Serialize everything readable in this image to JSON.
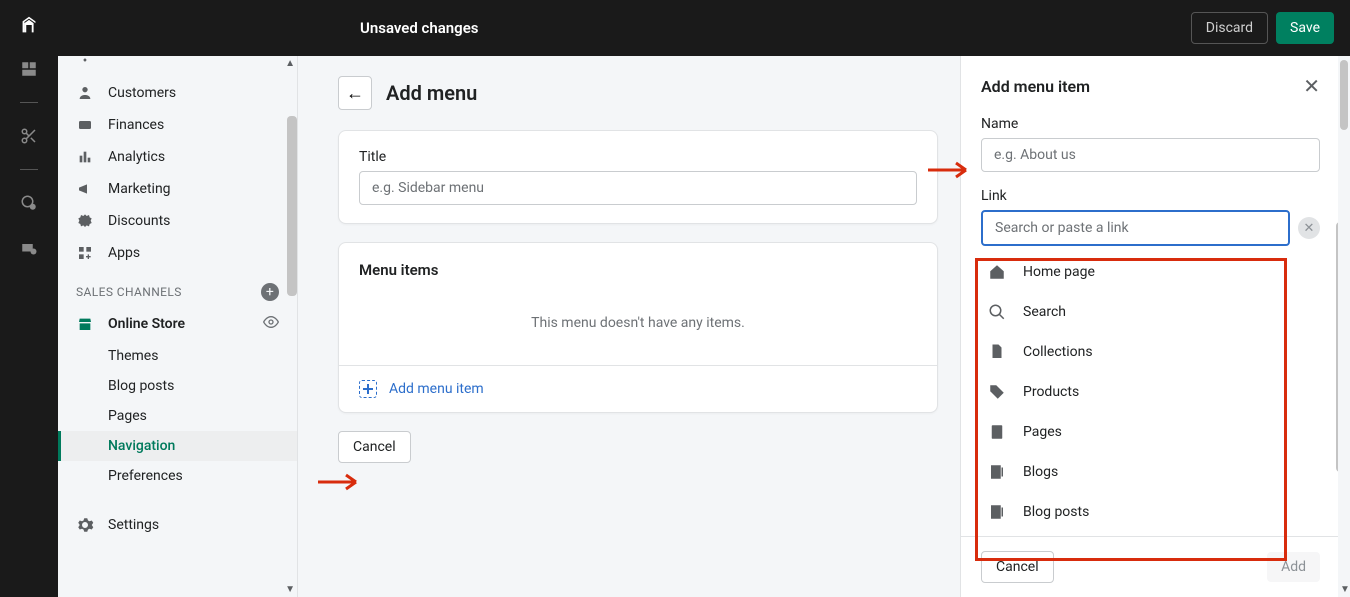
{
  "topbar": {
    "title": "Unsaved changes",
    "discard": "Discard",
    "save": "Save"
  },
  "sidebar": {
    "items": [
      {
        "label": "Customers"
      },
      {
        "label": "Finances"
      },
      {
        "label": "Analytics"
      },
      {
        "label": "Marketing"
      },
      {
        "label": "Discounts"
      },
      {
        "label": "Apps"
      }
    ],
    "section": "SALES CHANNELS",
    "channel": "Online Store",
    "subs": [
      {
        "label": "Themes"
      },
      {
        "label": "Blog posts"
      },
      {
        "label": "Pages"
      },
      {
        "label": "Navigation"
      },
      {
        "label": "Preferences"
      }
    ],
    "settings": "Settings"
  },
  "main": {
    "heading": "Add menu",
    "title_label": "Title",
    "title_placeholder": "e.g. Sidebar menu",
    "menu_items_heading": "Menu items",
    "empty_msg": "This menu doesn't have any items.",
    "add_menu_item": "Add menu item",
    "cancel": "Cancel"
  },
  "panel": {
    "heading": "Add menu item",
    "name_label": "Name",
    "name_placeholder": "e.g. About us",
    "link_label": "Link",
    "link_placeholder": "Search or paste a link",
    "options": [
      {
        "label": "Home page",
        "icon": "home"
      },
      {
        "label": "Search",
        "icon": "search"
      },
      {
        "label": "Collections",
        "icon": "collections"
      },
      {
        "label": "Products",
        "icon": "tag"
      },
      {
        "label": "Pages",
        "icon": "page"
      },
      {
        "label": "Blogs",
        "icon": "blog"
      },
      {
        "label": "Blog posts",
        "icon": "blog"
      }
    ],
    "cancel": "Cancel",
    "add": "Add"
  }
}
